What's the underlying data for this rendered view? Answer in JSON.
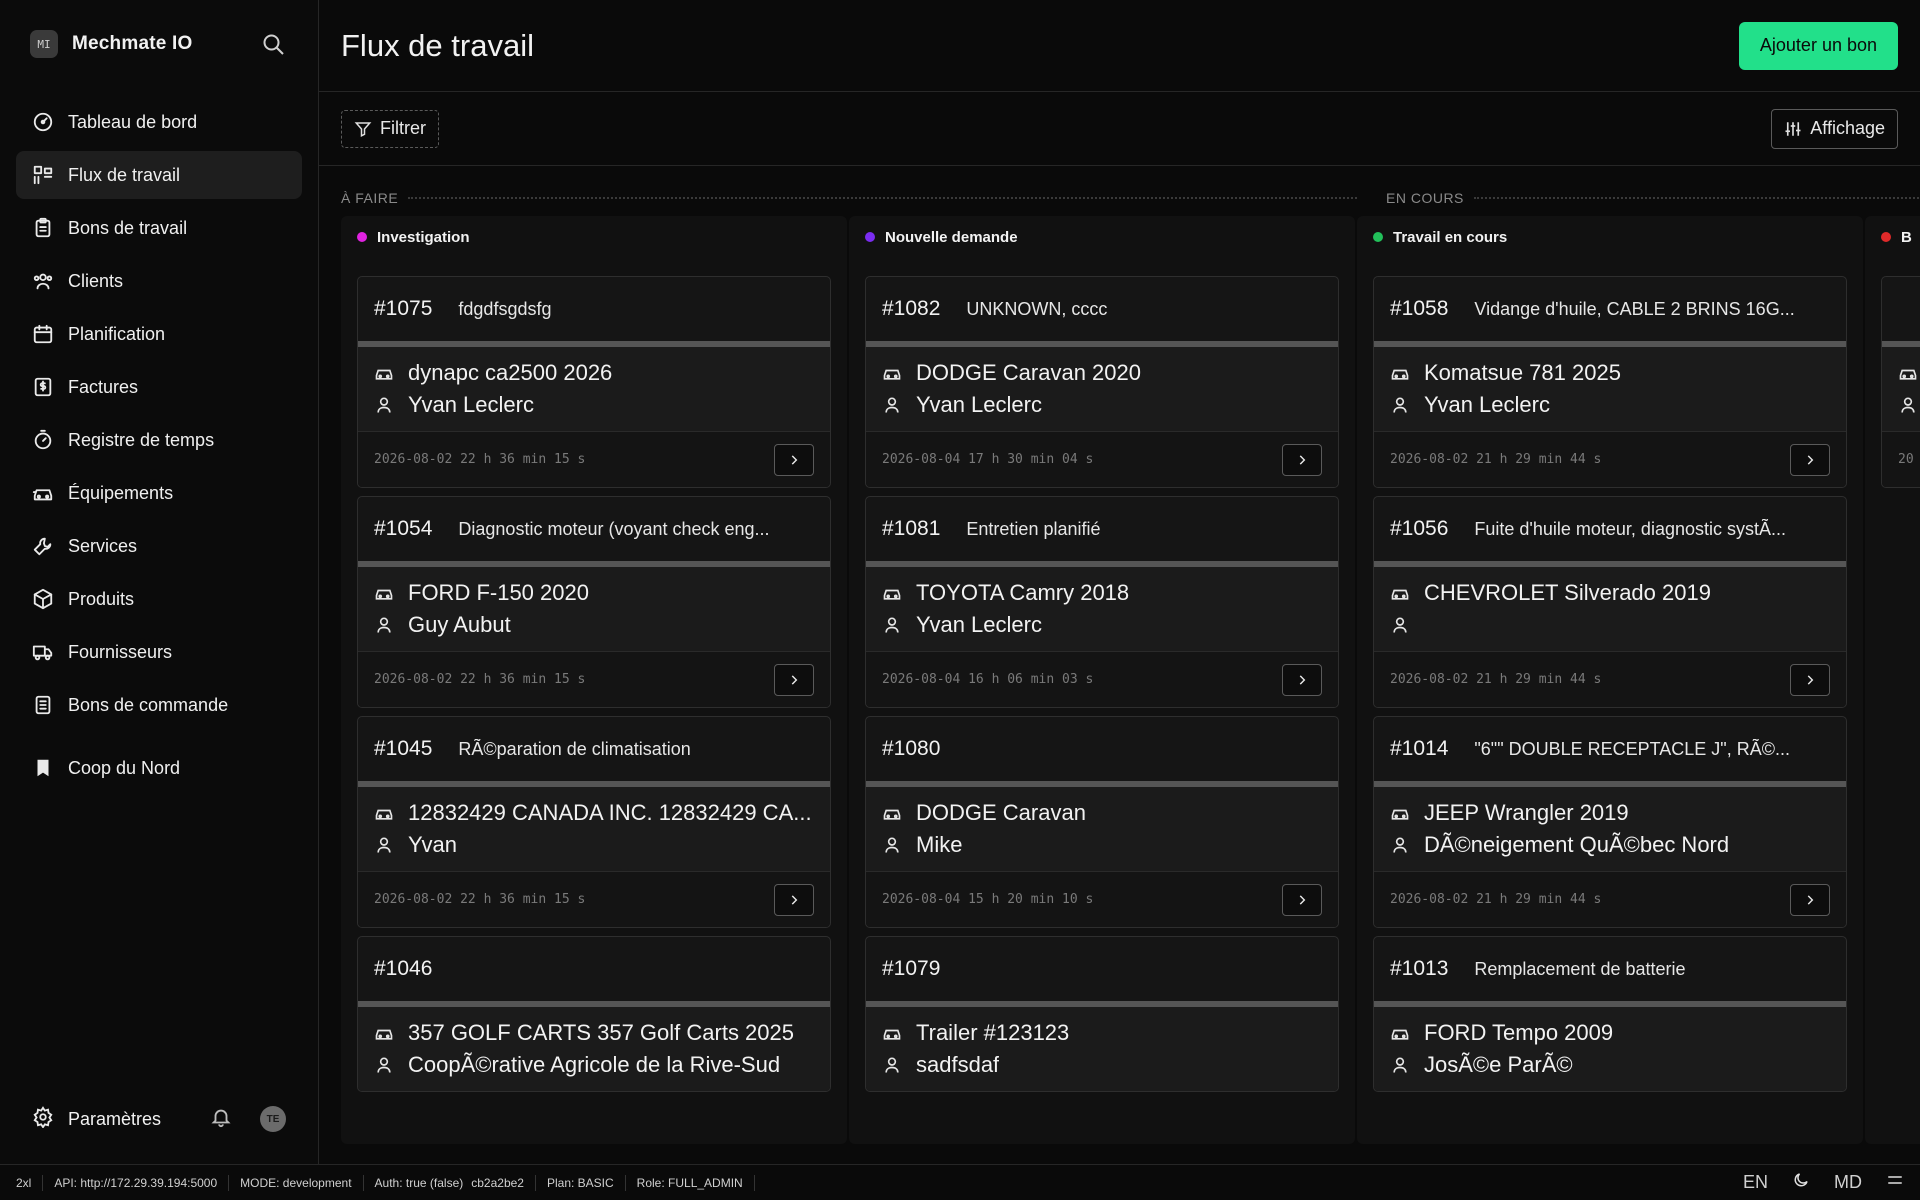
{
  "brand": {
    "logo": "MI",
    "name": "Mechmate IO"
  },
  "nav": [
    {
      "label": "Tableau de bord",
      "icon": "gauge-icon",
      "active": false
    },
    {
      "label": "Flux de travail",
      "icon": "workflow-icon",
      "active": true
    },
    {
      "label": "Bons de travail",
      "icon": "clipboard-icon",
      "active": false
    },
    {
      "label": "Clients",
      "icon": "users-icon",
      "active": false
    },
    {
      "label": "Planification",
      "icon": "calendar-icon",
      "active": false
    },
    {
      "label": "Factures",
      "icon": "invoice-icon",
      "active": false
    },
    {
      "label": "Registre de temps",
      "icon": "timer-icon",
      "active": false
    },
    {
      "label": "Équipements",
      "icon": "car-icon",
      "active": false
    },
    {
      "label": "Services",
      "icon": "wrench-icon",
      "active": false
    },
    {
      "label": "Produits",
      "icon": "box-icon",
      "active": false
    },
    {
      "label": "Fournisseurs",
      "icon": "truck-icon",
      "active": false
    },
    {
      "label": "Bons de commande",
      "icon": "list-icon",
      "active": false
    }
  ],
  "workspace": {
    "label": "Coop du Nord",
    "icon": "bookmark-icon"
  },
  "footer": {
    "settings": "Paramètres",
    "avatar": "TE"
  },
  "header": {
    "title": "Flux de travail",
    "add_button": "Ajouter un bon"
  },
  "toolbar": {
    "filter": "Filtrer",
    "display": "Affichage"
  },
  "groups": [
    {
      "label": "À FAIRE"
    },
    {
      "label": "EN COURS"
    }
  ],
  "columns": [
    {
      "title": "Investigation",
      "color": "#e022e0",
      "cards": [
        {
          "num": "#1075",
          "title": "fdgdfsgdsfg",
          "vehicle": "dynapc ca2500 2026",
          "customer": "Yvan Leclerc",
          "time": "2026-08-02 22 h 36 min 15 s"
        },
        {
          "num": "#1054",
          "title": "Diagnostic moteur (voyant check eng...",
          "vehicle": "FORD F-150 2020",
          "customer": "Guy Aubut",
          "time": "2026-08-02 22 h 36 min 15 s"
        },
        {
          "num": "#1045",
          "title": "RÃ©paration de climatisation",
          "vehicle": "12832429 CANADA INC. 12832429 CA...",
          "customer": "Yvan",
          "time": "2026-08-02 22 h 36 min 15 s"
        },
        {
          "num": "#1046",
          "title": "",
          "vehicle": "357 GOLF CARTS 357 Golf Carts 2025",
          "customer": "CoopÃ©rative Agricole de la Rive-Sud",
          "time": ""
        }
      ]
    },
    {
      "title": "Nouvelle demande",
      "color": "#7a2cf0",
      "cards": [
        {
          "num": "#1082",
          "title": "UNKNOWN, cccc",
          "vehicle": "DODGE Caravan 2020",
          "customer": "Yvan Leclerc",
          "time": "2026-08-04 17 h 30 min 04 s"
        },
        {
          "num": "#1081",
          "title": "Entretien planifié",
          "vehicle": "TOYOTA Camry 2018",
          "customer": "Yvan Leclerc",
          "time": "2026-08-04 16 h 06 min 03 s"
        },
        {
          "num": "#1080",
          "title": "",
          "vehicle": "DODGE Caravan",
          "customer": "Mike",
          "time": "2026-08-04 15 h 20 min 10 s"
        },
        {
          "num": "#1079",
          "title": "",
          "vehicle": "Trailer #123123",
          "customer": "sadfsdaf",
          "time": ""
        }
      ]
    },
    {
      "title": "Travail en cours",
      "color": "#22c05a",
      "cards": [
        {
          "num": "#1058",
          "title": "Vidange d'huile, CABLE 2 BRINS 16G...",
          "vehicle": "Komatsue 781 2025",
          "customer": "Yvan Leclerc",
          "time": "2026-08-02 21 h 29 min 44 s"
        },
        {
          "num": "#1056",
          "title": "Fuite d'huile moteur, diagnostic systÃ...",
          "vehicle": "CHEVROLET Silverado 2019",
          "customer": "",
          "time": "2026-08-02 21 h 29 min 44 s"
        },
        {
          "num": "#1014",
          "title": "\"6\"\" DOUBLE RECEPTACLE J\", RÃ©...",
          "vehicle": "JEEP Wrangler 2019",
          "customer": "DÃ©neigement QuÃ©bec Nord",
          "time": "2026-08-02 21 h 29 min 44 s"
        },
        {
          "num": "#1013",
          "title": "Remplacement de batterie",
          "vehicle": "FORD Tempo 2009",
          "customer": "JosÃ©e ParÃ©",
          "time": ""
        }
      ]
    },
    {
      "title": "B",
      "color": "#e02a2a",
      "cards": [
        {
          "num": "",
          "title": "",
          "vehicle": "",
          "customer": "",
          "time": "20"
        }
      ]
    }
  ],
  "statusbar": {
    "breakpoint": "2xl",
    "api": "API: http://172.29.39.194:5000",
    "mode": "MODE: development",
    "auth": "Auth: true (false)",
    "hash": "cb2a2be2",
    "plan": "Plan: BASIC",
    "role": "Role: FULL_ADMIN",
    "lang": "EN",
    "size": "MD"
  }
}
